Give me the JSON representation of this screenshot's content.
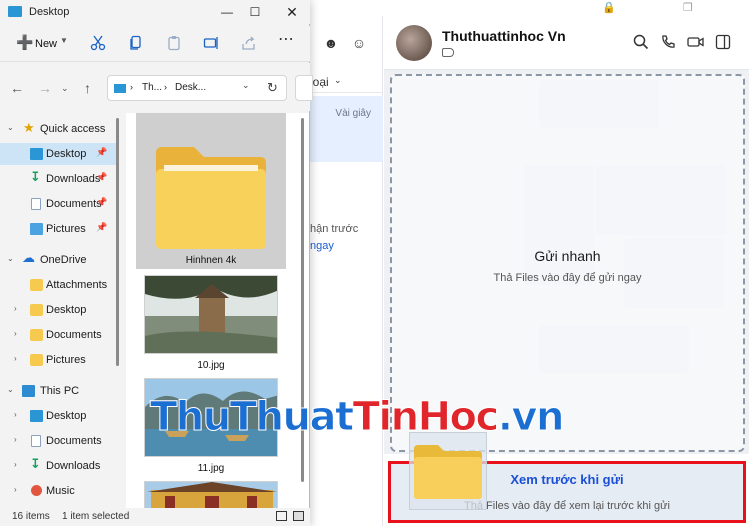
{
  "explorer": {
    "title": "Desktop",
    "toolbar": {
      "new_label": "New"
    },
    "address": {
      "seg1": "Th...",
      "seg2": "Desk..."
    },
    "nav": [
      {
        "key": "quick_access",
        "label": "Quick access",
        "type": "star"
      },
      {
        "key": "desktop",
        "label": "Desktop",
        "type": "desk",
        "pinned": true
      },
      {
        "key": "downloads",
        "label": "Downloads",
        "type": "dl",
        "pinned": true
      },
      {
        "key": "documents",
        "label": "Documents",
        "type": "docs",
        "pinned": true
      },
      {
        "key": "pictures",
        "label": "Pictures",
        "type": "pics",
        "pinned": true
      },
      {
        "key": "onedrive",
        "label": "OneDrive",
        "type": "cloud"
      },
      {
        "key": "attachments",
        "label": "Attachments",
        "type": "folder"
      },
      {
        "key": "od_desktop",
        "label": "Desktop",
        "type": "folder"
      },
      {
        "key": "od_documents",
        "label": "Documents",
        "type": "folder"
      },
      {
        "key": "od_pictures",
        "label": "Pictures",
        "type": "folder"
      },
      {
        "key": "this_pc",
        "label": "This PC",
        "type": "pc"
      },
      {
        "key": "pc_desktop",
        "label": "Desktop",
        "type": "desk"
      },
      {
        "key": "pc_documents",
        "label": "Documents",
        "type": "docs"
      },
      {
        "key": "pc_downloads",
        "label": "Downloads",
        "type": "dl"
      },
      {
        "key": "pc_music",
        "label": "Music",
        "type": "music"
      }
    ],
    "files": [
      {
        "name": "Hinhnen 4k",
        "kind": "folder",
        "selected": true
      },
      {
        "name": "10.jpg",
        "kind": "image"
      },
      {
        "name": "11.jpg",
        "kind": "image"
      },
      {
        "name": "",
        "kind": "image"
      }
    ],
    "status": {
      "count": "16 items",
      "selection": "1 item selected"
    }
  },
  "chat": {
    "contact_name": "Thuthuattinhoc Vn",
    "list": {
      "filter_label": "loại",
      "row_time": "Vài giây",
      "snippet_line1": "hận trước",
      "snippet_line2": "ngay"
    },
    "drop_zone": {
      "title": "Gửi nhanh",
      "subtitle": "Thả Files vào đây để gửi ngay"
    },
    "preview_zone": {
      "title": "Xem trước khi gửi",
      "subtitle": "Thả Files vào đây để xem lại trước khi gửi"
    }
  },
  "watermark": {
    "part1": "ThuThuat",
    "part2": "TinHoc",
    "part3": ".vn"
  },
  "colors": {
    "accent": "#1a62c4",
    "highlight_red": "#e8101b",
    "selection_blue": "#cde4f7"
  }
}
